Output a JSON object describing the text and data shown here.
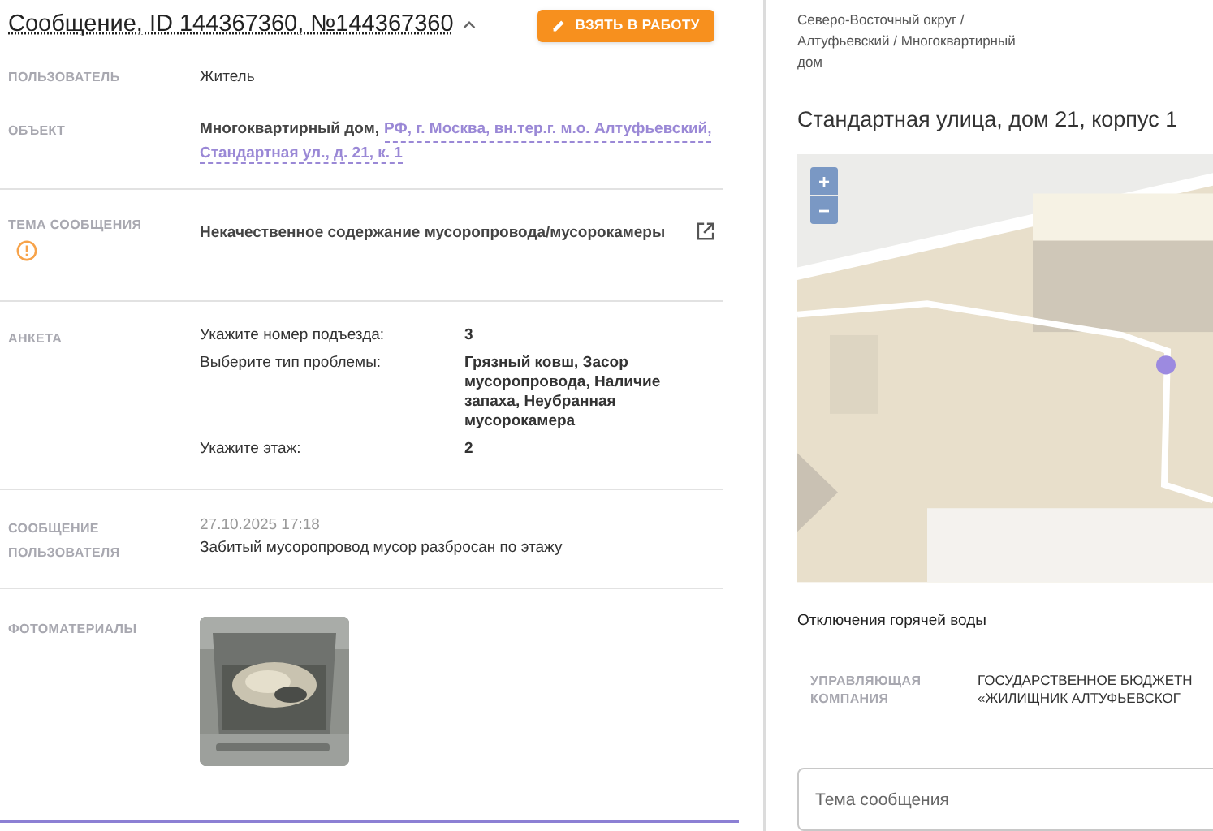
{
  "header": {
    "title": "Сообщение, ID 144367360, №144367360",
    "expanded": true,
    "action_button": "ВЗЯТЬ В РАБОТУ"
  },
  "user": {
    "label": "ПОЛЬЗОВАТЕЛЬ",
    "value": "Житель"
  },
  "object": {
    "label": "ОБЪЕКТ",
    "type": "Многоквартирный дом,",
    "address_lines": [
      "РФ, г. Москва, вн.тер.г. м.о. Алтуфьевский,",
      "Стандартная ул., д. 21, к. 1"
    ]
  },
  "topic": {
    "label": "ТЕМА СООБЩЕНИЯ",
    "value": "Некачественное содержание мусоропровода/мусорокамеры",
    "warning": true
  },
  "survey": {
    "label": "АНКЕТА",
    "rows": [
      {
        "question": "Укажите номер подъезда:",
        "answer": "3"
      },
      {
        "question": "Выберите тип проблемы:",
        "answer": "Грязный ковш, Засор мусоропровода, Наличие запаха, Неубранная мусорокамера"
      },
      {
        "question": "Укажите этаж:",
        "answer": "2"
      }
    ]
  },
  "user_message": {
    "label": "СООБЩЕНИЕ ПОЛЬЗОВАТЕЛЯ",
    "date": "27.10.2025 17:18",
    "text": "Забитый мусоропровод мусор разбросан по этажу"
  },
  "photos": {
    "label": "ФОТОМАТЕРИАЛЫ"
  },
  "right": {
    "breadcrumb": "Северо-Восточный округ / Алтуфьевский / Многоквартирный дом",
    "address": "Стандартная улица, дом 21, корпус 1",
    "map": {
      "zoom_in": "+",
      "zoom_out": "−"
    },
    "hot_water": "Отключения горячей воды",
    "company": {
      "label": "УПРАВЛЯЮЩАЯ КОМПАНИЯ",
      "lines": [
        "ГОСУДАРСТВЕННОЕ БЮДЖЕТН",
        "«ЖИЛИЩНИК АЛТУФЬЕВСКОГ"
      ]
    },
    "topic_field": {
      "placeholder": "Тема сообщения"
    }
  }
}
